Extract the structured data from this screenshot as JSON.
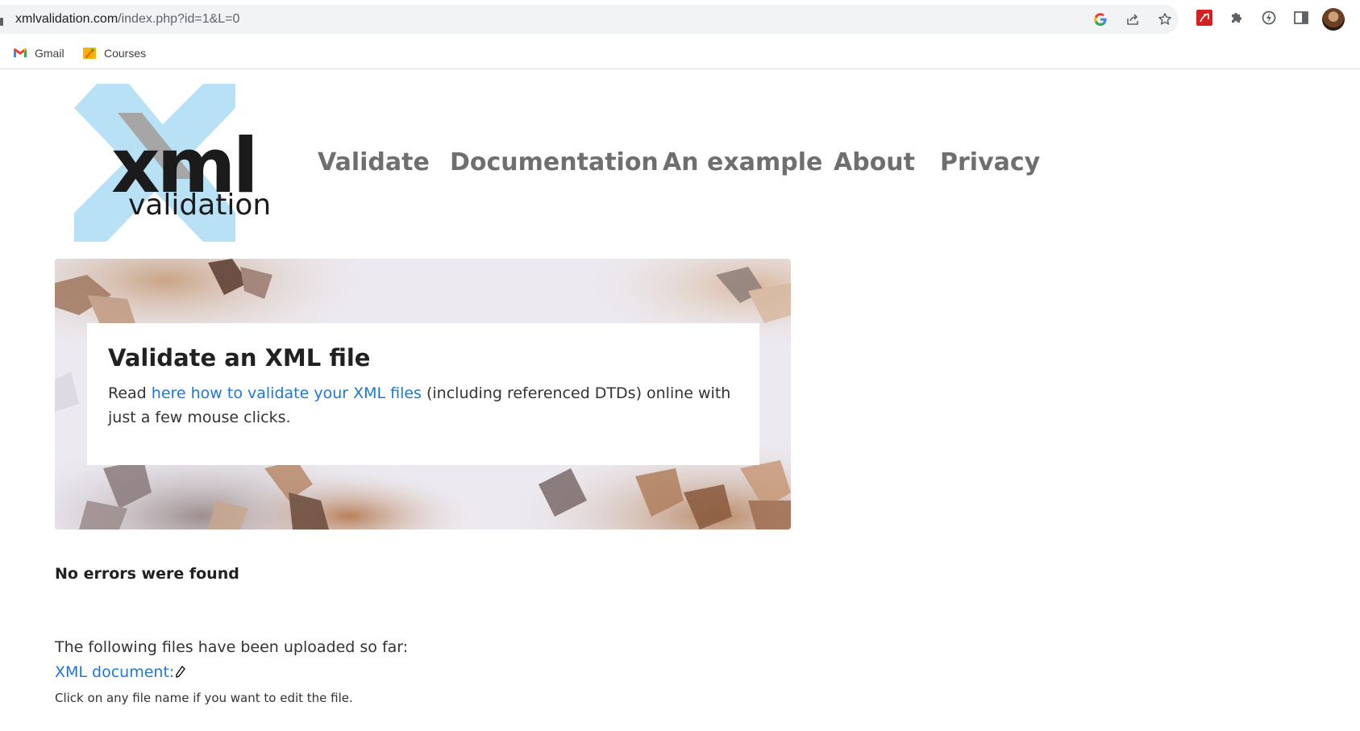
{
  "browser": {
    "url_host": "xmlvalidation.com",
    "url_path": "/index.php?id=1&L=0",
    "omnibox_icons": [
      "google-lens-icon",
      "share-icon",
      "bookmark-star-icon"
    ],
    "toolbar_icons": [
      "pdf-extension-icon",
      "extensions-puzzle-icon",
      "performance-icon",
      "side-panel-icon",
      "profile-avatar"
    ],
    "bookmarks": [
      {
        "label": "Gmail",
        "icon": "gmail-icon"
      },
      {
        "label": "Courses",
        "icon": "courses-icon"
      }
    ]
  },
  "site": {
    "logo": {
      "word1": "xml",
      "word2": "validation"
    },
    "nav": [
      "Validate",
      "Documentation",
      "An example",
      "About",
      "Privacy"
    ]
  },
  "hero": {
    "title": "Validate an XML file",
    "text_before": "Read ",
    "link_text": "here how to validate your XML files",
    "text_after": " (including referenced DTDs) online with just a few mouse clicks."
  },
  "result": {
    "status": "No errors were found",
    "uploaded_label": "The following files have been uploaded so far:",
    "document_link": "XML document:",
    "hint": "Click on any file name if you want to edit the file."
  },
  "colors": {
    "link": "#2077d6",
    "nav": "#6f6f6f",
    "logo_x": "#b9e1f5"
  }
}
